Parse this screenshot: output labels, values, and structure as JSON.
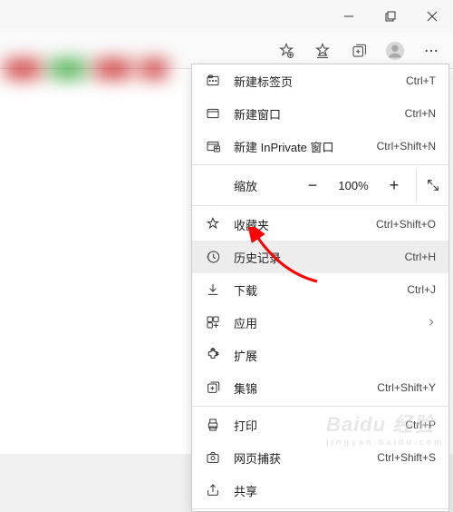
{
  "titlebar": {
    "min": "minimize",
    "max": "maximize",
    "close": "close"
  },
  "toolbar": {
    "star": "star-plus-icon",
    "favs": "favorites-icon",
    "collections": "collections-icon",
    "profile": "profile-icon",
    "more": "more-icon"
  },
  "menu": {
    "new_tab": {
      "label": "新建标签页",
      "shortcut": "Ctrl+T"
    },
    "new_window": {
      "label": "新建窗口",
      "shortcut": "Ctrl+N"
    },
    "new_inprivate": {
      "label": "新建 InPrivate 窗口",
      "shortcut": "Ctrl+Shift+N"
    },
    "zoom": {
      "label": "缩放",
      "value": "100%"
    },
    "favorites": {
      "label": "收藏夹",
      "shortcut": "Ctrl+Shift+O"
    },
    "history": {
      "label": "历史记录",
      "shortcut": "Ctrl+H"
    },
    "downloads": {
      "label": "下载",
      "shortcut": "Ctrl+J"
    },
    "apps": {
      "label": "应用"
    },
    "extensions": {
      "label": "扩展"
    },
    "collections": {
      "label": "集锦",
      "shortcut": "Ctrl+Shift+Y"
    },
    "print": {
      "label": "打印",
      "shortcut": "Ctrl+P"
    },
    "capture": {
      "label": "网页捕获",
      "shortcut": "Ctrl+Shift+S"
    },
    "share": {
      "label": "共享"
    }
  },
  "watermark": {
    "main": "Baidu 经验",
    "sub": "jingyan.baidu.com"
  }
}
